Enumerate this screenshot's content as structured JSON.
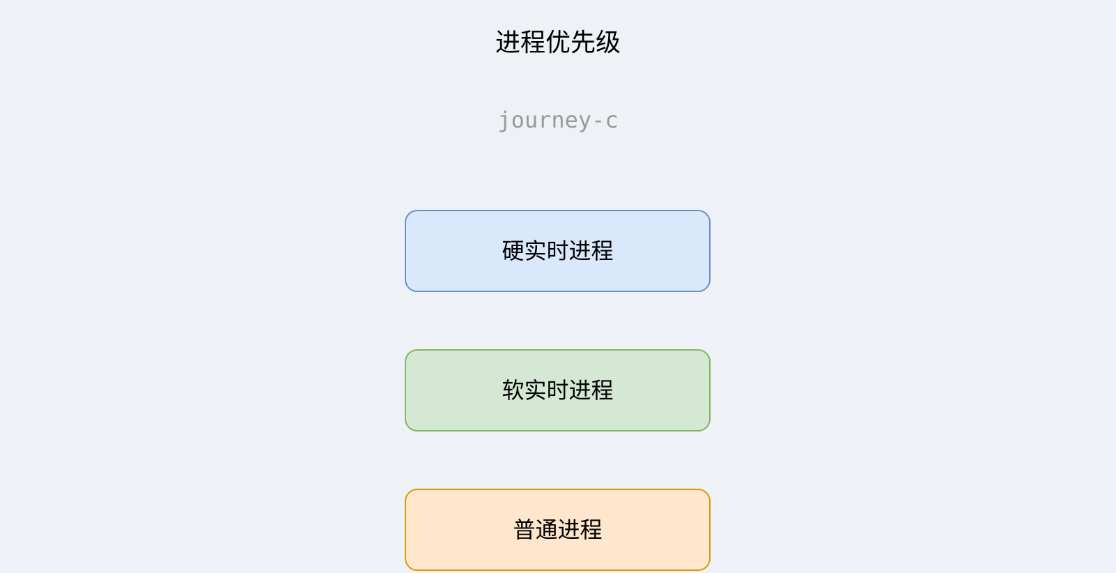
{
  "diagram": {
    "title": "进程优先级",
    "author": "journey-c",
    "boxes": [
      {
        "label": "硬实时进程",
        "fill": "#dae8fc",
        "stroke": "#6c8ebf"
      },
      {
        "label": "软实时进程",
        "fill": "#d5e8d4",
        "stroke": "#82b366"
      },
      {
        "label": "普通进程",
        "fill": "#ffe6cc",
        "stroke": "#d79b00"
      }
    ]
  }
}
